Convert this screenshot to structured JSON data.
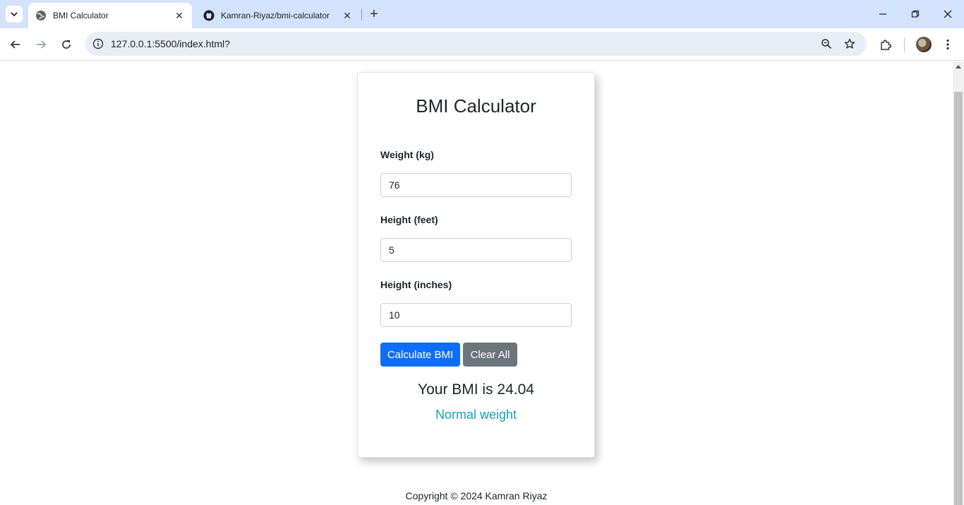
{
  "browser": {
    "tabs": [
      {
        "title": "BMI Calculator",
        "active": true
      },
      {
        "title": "Kamran-Riyaz/bmi-calculator",
        "active": false
      }
    ],
    "url": "127.0.0.1:5500/index.html?"
  },
  "app": {
    "title": "BMI Calculator",
    "fields": {
      "weight": {
        "label": "Weight (kg)",
        "value": "76"
      },
      "height_feet": {
        "label": "Height (feet)",
        "value": "5"
      },
      "height_inches": {
        "label": "Height (inches)",
        "value": "10"
      }
    },
    "buttons": {
      "calculate": "Calculate BMI",
      "clear": "Clear All"
    },
    "result": "Your BMI is 24.04",
    "category": "Normal weight",
    "footer": "Copyright © 2024 Kamran Riyaz"
  },
  "colors": {
    "primary": "#0d6efd",
    "secondary": "#6c757d",
    "status": "#17a2b8"
  }
}
